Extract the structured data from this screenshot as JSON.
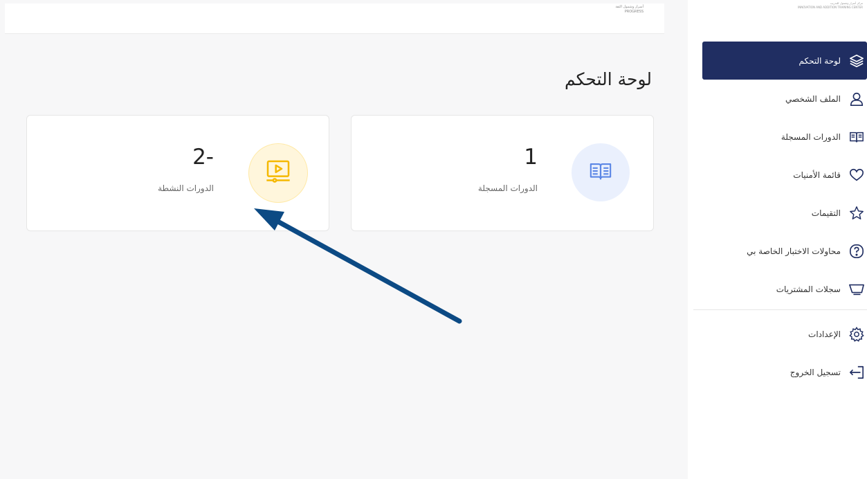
{
  "header": {
    "logo_text": "أسرار وشمول الثقة",
    "logo_subtext": "PROGRESS"
  },
  "sidebar": {
    "logo_text": "مركز أسرار وشمول للتدريب",
    "logo_subtext": "INNOVATION AND ADDITION TRAINING CENTER",
    "items": [
      {
        "label": "لوحة التحكم",
        "icon": "layers-icon",
        "active": true
      },
      {
        "label": "الملف الشخصي",
        "icon": "user-icon"
      },
      {
        "label": "الدورات المسجلة",
        "icon": "book-icon"
      },
      {
        "label": "قائمة الأمنيات",
        "icon": "heart-icon"
      },
      {
        "label": "التقيمات",
        "icon": "star-icon"
      },
      {
        "label": "محاولات الاختبار الخاصة بي",
        "icon": "question-icon"
      },
      {
        "label": "سجلات المشتريات",
        "icon": "cart-icon"
      },
      {
        "label": "الإعدادات",
        "icon": "gear-icon"
      },
      {
        "label": "تسجيل الخروج",
        "icon": "logout-icon"
      }
    ]
  },
  "main": {
    "title": "لوحة التحكم",
    "cards": [
      {
        "value": "1",
        "label": "الدورات المسجلة",
        "icon": "open-book-icon",
        "color": "#5b86e5"
      },
      {
        "value": "2-",
        "label": "الدورات النشطة",
        "icon": "video-play-icon",
        "color": "#f5b800"
      }
    ]
  },
  "annotation": {
    "arrow_color": "#0c4a84"
  }
}
